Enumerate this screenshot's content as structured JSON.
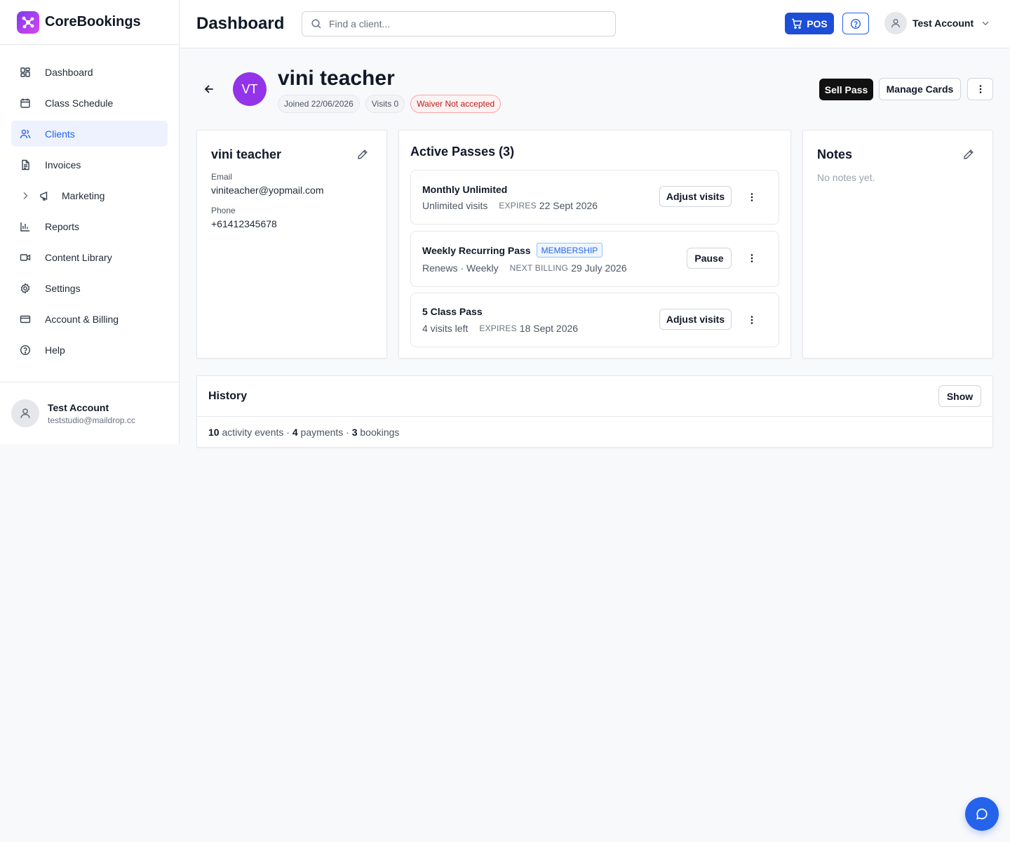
{
  "brand": {
    "name": "CoreBookings"
  },
  "header": {
    "title": "Dashboard",
    "search_placeholder": "Find a client...",
    "pos_label": "POS",
    "account_name": "Test Account"
  },
  "sidebar": {
    "items": [
      {
        "label": "Dashboard",
        "icon": "grid-icon"
      },
      {
        "label": "Class Schedule",
        "icon": "calendar-icon"
      },
      {
        "label": "Clients",
        "icon": "users-icon",
        "active": true
      },
      {
        "label": "Invoices",
        "icon": "file-icon"
      },
      {
        "label": "Marketing",
        "icon": "megaphone-icon",
        "expandable": true
      },
      {
        "label": "Reports",
        "icon": "bar-chart-icon"
      },
      {
        "label": "Content Library",
        "icon": "video-icon"
      },
      {
        "label": "Settings",
        "icon": "gear-icon"
      },
      {
        "label": "Account & Billing",
        "icon": "credit-card-icon"
      },
      {
        "label": "Help",
        "icon": "help-circle-icon"
      }
    ],
    "footer": {
      "name": "Test Account",
      "email": "teststudio@maildrop.cc"
    }
  },
  "client": {
    "initials": "VT",
    "name": "vini teacher",
    "joined": "Joined 22/06/2026",
    "visits": "Visits 0",
    "waiver": "Waiver Not accepted",
    "avatar_color": "#9333ea"
  },
  "actions": {
    "sell_pass": "Sell Pass",
    "manage_cards": "Manage Cards"
  },
  "info": {
    "name": "vini teacher",
    "email_label": "Email",
    "email": "viniteacher@yopmail.com",
    "phone_label": "Phone",
    "phone": "+61412345678"
  },
  "passes": {
    "title": "Active Passes (3)",
    "items": [
      {
        "name": "Monthly Unlimited",
        "badge": "",
        "status": "Unlimited visits",
        "date_label": "EXPIRES",
        "date": "22 Sept 2026",
        "action": "Adjust visits"
      },
      {
        "name": "Weekly Recurring Pass",
        "badge": "MEMBERSHIP",
        "status": "Renews · Weekly",
        "date_label": "NEXT BILLING",
        "date": "29 July 2026",
        "action": "Pause"
      },
      {
        "name": "5 Class Pass",
        "badge": "",
        "status": "4 visits left",
        "date_label": "EXPIRES",
        "date": "18 Sept 2026",
        "action": "Adjust visits"
      }
    ]
  },
  "notes": {
    "title": "Notes",
    "empty": "No notes yet."
  },
  "history": {
    "title": "History",
    "show_label": "Show",
    "activity_count": "10",
    "activity_label": "activity events",
    "payments_count": "4",
    "payments_label": "payments",
    "bookings_count": "3",
    "bookings_label": "bookings"
  },
  "colors": {
    "accent": "#2563eb",
    "pos": "#1d4ed8",
    "brand_gradient": [
      "#7c3aed",
      "#d946ef"
    ]
  }
}
